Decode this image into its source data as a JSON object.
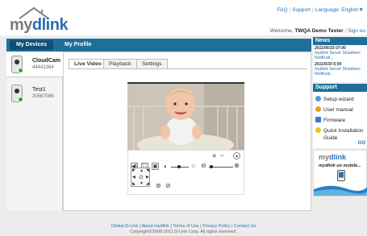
{
  "header": {
    "logo_prefix": "my",
    "logo_suffix": "dlink",
    "faq": "FAQ",
    "support": "Support",
    "language": "Language: English▼",
    "welcome_label": "Welcome,",
    "user_name": "TWQA Demo Tester",
    "sign_out": "Sign ou"
  },
  "nav": {
    "my_devices": "My Devices",
    "my_profile": "My Profile"
  },
  "devices": [
    {
      "name": "CloudCam",
      "id": "44441364"
    },
    {
      "name": "Test1",
      "id": "30567086"
    }
  ],
  "tabs": [
    "Live Video",
    "Playback",
    "Settings"
  ],
  "news": {
    "title": "News",
    "items": [
      {
        "date": "2011/06/15 07:00",
        "text": "mydlink Server Shutdown Notificati..."
      },
      {
        "date": "2011/6/30 6:00",
        "text": "mydlink Server Shutdown Notificati..."
      }
    ]
  },
  "support_box": {
    "title": "Support",
    "items": [
      "Setup wizard",
      "User manual",
      "Firmware",
      "Quick Installation",
      "Guide"
    ],
    "go": "GO"
  },
  "promo": {
    "logo_prefix": "my",
    "logo_suffix": "dlink",
    "text": "mydlink on mobile..."
  },
  "footer": {
    "links": [
      "Global D-Link",
      "About mydlink",
      "Terms of Use",
      "Privacy Policy",
      "Contact Us"
    ],
    "copyright": "Copyright©2008-2011 D-Link Corp. All rights reserved."
  },
  "colors": {
    "brand_blue": "#1f6f9a",
    "link_blue": "#2b6fb1",
    "online_green": "#2ea42e"
  }
}
